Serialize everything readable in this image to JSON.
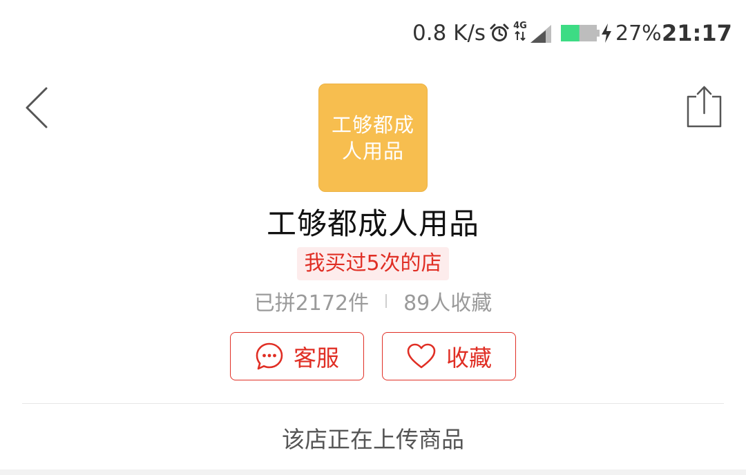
{
  "status_bar": {
    "net_speed": "0.8 K/s",
    "network_type": "4G",
    "battery_percent": "27%",
    "battery_level": 0.27,
    "time": "21:17",
    "icons": [
      "alarm-icon",
      "4g-icon",
      "signal-icon",
      "battery-icon",
      "charging-icon"
    ]
  },
  "nav": {
    "back_icon": "chevron-left-icon",
    "share_icon": "share-icon"
  },
  "shop": {
    "logo_text": "工够都成人用品",
    "name": "工够都成人用品",
    "badge": "我买过5次的店",
    "sold": "已拼2172件",
    "favorites": "89人收藏",
    "logo_color": "#f7be4f"
  },
  "actions": {
    "service_label": "客服",
    "service_icon": "chat-bubble-icon",
    "favorite_label": "收藏",
    "favorite_icon": "heart-icon"
  },
  "content": {
    "empty_message": "该店正在上传商品"
  },
  "colors": {
    "accent": "#e02e24",
    "badge_bg": "#fdecec",
    "muted_text": "#9a9a9a"
  }
}
